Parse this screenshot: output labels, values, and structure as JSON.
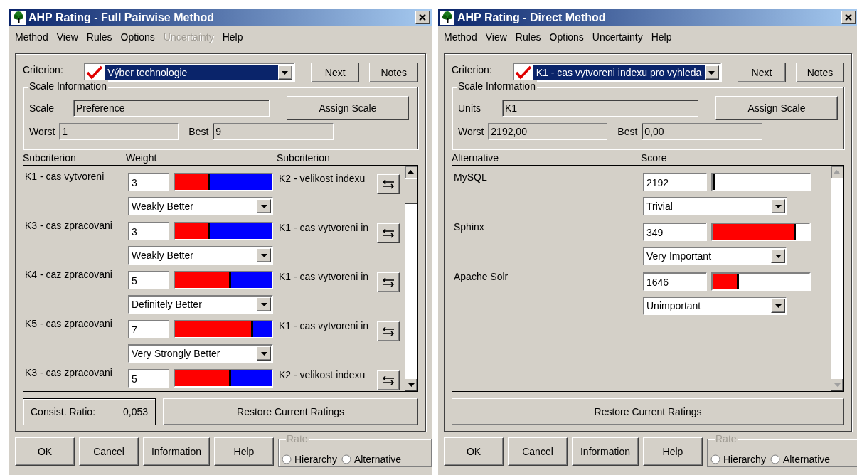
{
  "windows": [
    {
      "kind": "pairwise",
      "title": "AHP Rating - Full Pairwise Method",
      "menu": [
        {
          "label": "Method",
          "disabled": false
        },
        {
          "label": "View",
          "disabled": false
        },
        {
          "label": "Rules",
          "disabled": false
        },
        {
          "label": "Options",
          "disabled": false
        },
        {
          "label": "Uncertainty",
          "disabled": true
        },
        {
          "label": "Help",
          "disabled": false
        }
      ],
      "criterion": {
        "label": "Criterion:",
        "value": "Výber technologie"
      },
      "next_button": "Next",
      "notes_button": "Notes",
      "scale": {
        "legend": "Scale Information",
        "field_label": "Scale",
        "field_value": "Preference",
        "assign_button": "Assign Scale",
        "worst_label": "Worst",
        "worst_value": "1",
        "best_label": "Best",
        "best_value": "9"
      },
      "headers": [
        "Subcriterion",
        "Weight",
        "Subcriterion"
      ],
      "rows": [
        {
          "left": "K1 - cas vytvoreni",
          "value": "3",
          "level": 0.36,
          "verbal": "Weakly Better",
          "right": "K2 - velikost indexu"
        },
        {
          "left": "K3 - cas zpracovani",
          "value": "3",
          "level": 0.36,
          "verbal": "Weakly Better",
          "right": "K1 - cas vytvoreni in"
        },
        {
          "left": "K4 - caz zpracovani",
          "value": "5",
          "level": 0.58,
          "verbal": "Definitely Better",
          "right": "K1 - cas vytvoreni in"
        },
        {
          "left": "K5 - cas zpracovani",
          "value": "7",
          "level": 0.81,
          "verbal": "Very Strongly Better",
          "right": "K1 - cas vytvoreni in"
        },
        {
          "left": "K3 - cas zpracovani",
          "value": "5",
          "level": 0.58,
          "right": "K2 - velikost indexu"
        }
      ],
      "scroll_disabled": false,
      "consistency": {
        "label": "Consist. Ratio:",
        "value": "0,053"
      },
      "restore_button": "Restore Current Ratings",
      "footer_buttons": [
        "OK",
        "Cancel",
        "Information",
        "Help"
      ],
      "rate": {
        "legend": "Rate",
        "options": [
          {
            "label": "Hierarchy",
            "selected": false
          },
          {
            "label": "Alternative",
            "selected": false
          }
        ]
      }
    },
    {
      "kind": "direct",
      "title": "AHP Rating - Direct Method",
      "menu": [
        {
          "label": "Method",
          "disabled": false
        },
        {
          "label": "View",
          "disabled": false
        },
        {
          "label": "Rules",
          "disabled": false
        },
        {
          "label": "Options",
          "disabled": false
        },
        {
          "label": "Uncertainty",
          "disabled": false
        },
        {
          "label": "Help",
          "disabled": false
        }
      ],
      "criterion": {
        "label": "Criterion:",
        "value": "K1 - cas vytvoreni indexu pro vyhleda"
      },
      "next_button": "Next",
      "notes_button": "Notes",
      "scale": {
        "legend": "Scale Information",
        "field_label": "Units",
        "field_value": "K1",
        "assign_button": "Assign Scale",
        "worst_label": "Worst",
        "worst_value": "2192,00",
        "best_label": "Best",
        "best_value": "0,00"
      },
      "headers": [
        "Alternative",
        "Score"
      ],
      "rows": [
        {
          "left": "MySQL",
          "value": "2192",
          "level": 0.02,
          "verbal": "Trivial"
        },
        {
          "left": "Sphinx",
          "value": "349",
          "level": 0.86,
          "verbal": "Very Important"
        },
        {
          "left": "Apache Solr",
          "value": "1646",
          "level": 0.27,
          "verbal": "Unimportant"
        }
      ],
      "scroll_disabled": true,
      "restore_button": "Restore Current Ratings",
      "footer_buttons": [
        "OK",
        "Cancel",
        "Information",
        "Help"
      ],
      "rate": {
        "legend": "Rate",
        "options": [
          {
            "label": "Hierarchy",
            "selected": false
          },
          {
            "label": "Alternative",
            "selected": false
          }
        ]
      }
    }
  ]
}
